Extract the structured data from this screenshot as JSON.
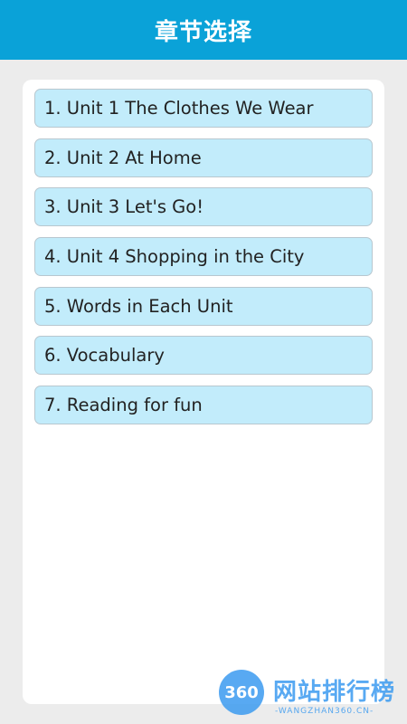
{
  "header": {
    "title": "章节选择"
  },
  "chapters": [
    {
      "label": "1. Unit 1 The Clothes We Wear"
    },
    {
      "label": "2. Unit 2 At Home"
    },
    {
      "label": "3. Unit 3 Let's Go!"
    },
    {
      "label": "4. Unit 4 Shopping in the City"
    },
    {
      "label": "5. Words in Each Unit"
    },
    {
      "label": "6. Vocabulary"
    },
    {
      "label": "7. Reading for fun"
    }
  ],
  "watermark": {
    "logo_text": "360",
    "title": "网站排行榜",
    "url": "-WANGZHAN360.CN-"
  },
  "colors": {
    "header_bg": "#0aa2d8",
    "item_bg": "#c2ecfb",
    "page_bg": "#ececec",
    "watermark": "#3c9bf0"
  }
}
